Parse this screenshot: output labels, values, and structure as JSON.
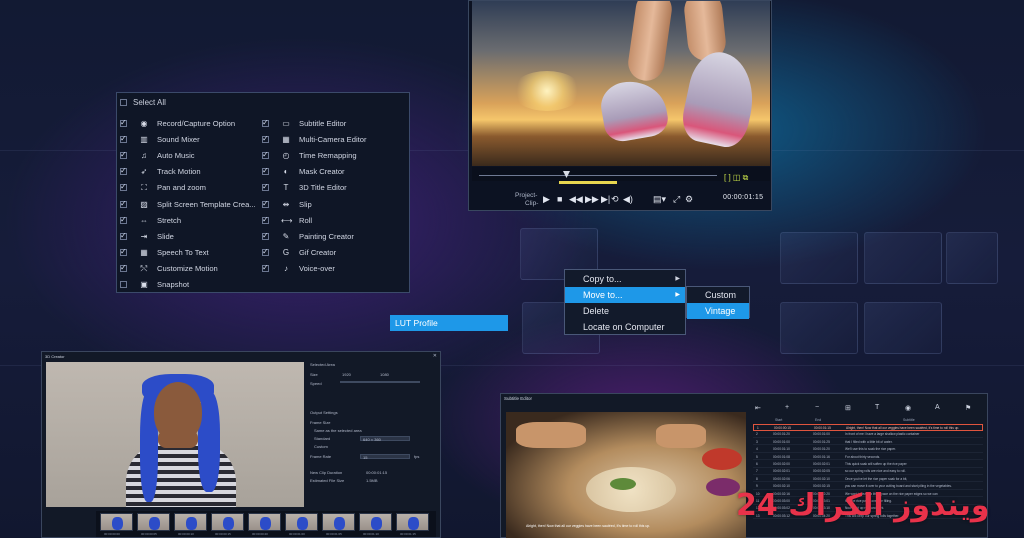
{
  "feature_panel": {
    "select_all": "Select All",
    "left_items": [
      {
        "label": "Record/Capture Option",
        "icon": "record-icon",
        "checked": true
      },
      {
        "label": "Sound Mixer",
        "icon": "sound-mixer-icon",
        "checked": true
      },
      {
        "label": "Auto Music",
        "icon": "music-note-icon",
        "checked": true
      },
      {
        "label": "Track Motion",
        "icon": "track-motion-icon",
        "checked": true
      },
      {
        "label": "Pan and zoom",
        "icon": "pan-zoom-icon",
        "checked": true
      },
      {
        "label": "Split Screen Template Crea...",
        "icon": "split-screen-icon",
        "checked": true
      },
      {
        "label": "Stretch",
        "icon": "stretch-icon",
        "checked": true
      },
      {
        "label": "Slide",
        "icon": "slide-icon",
        "checked": true
      },
      {
        "label": "Speech To Text",
        "icon": "speech-to-text-icon",
        "checked": true
      },
      {
        "label": "Customize Motion",
        "icon": "customize-motion-icon",
        "checked": true
      },
      {
        "label": "Snapshot",
        "icon": "camera-icon",
        "checked": false
      }
    ],
    "right_items": [
      {
        "label": "Subtitle Editor",
        "icon": "subtitle-icon",
        "checked": true
      },
      {
        "label": "Multi-Camera Editor",
        "icon": "multicam-icon",
        "checked": true
      },
      {
        "label": "Time Remapping",
        "icon": "clock-icon",
        "checked": true
      },
      {
        "label": "Mask Creator",
        "icon": "mask-icon",
        "checked": true
      },
      {
        "label": "3D Title Editor",
        "icon": "3d-title-icon",
        "checked": true
      },
      {
        "label": "Slip",
        "icon": "slip-icon",
        "checked": true
      },
      {
        "label": "Roll",
        "icon": "roll-icon",
        "checked": true
      },
      {
        "label": "Painting Creator",
        "icon": "paint-icon",
        "checked": true
      },
      {
        "label": "Gif Creator",
        "icon": "gif-icon",
        "checked": true
      },
      {
        "label": "Voice-over",
        "icon": "microphone-icon",
        "checked": true
      }
    ]
  },
  "preview": {
    "mode_label_1": "Project-",
    "mode_label_2": "Clip-",
    "timecode": "00:00:01:15"
  },
  "context_menu": {
    "items": [
      {
        "label": "Copy to...",
        "has_submenu": true
      },
      {
        "label": "Move to...",
        "has_submenu": true,
        "active": true
      },
      {
        "label": "Delete",
        "has_submenu": false
      },
      {
        "label": "Locate on Computer",
        "has_submenu": false
      }
    ],
    "submenu": [
      {
        "label": "Custom"
      },
      {
        "label": "Vintage",
        "active": true
      }
    ]
  },
  "lut_profile": "LUT Profile",
  "creator": {
    "title": "3D Creator",
    "selected_area": "Selected Area",
    "size_label": "Size",
    "w": "1920",
    "h": "1080",
    "speed_label": "Speed",
    "output_settings": "Output Settings",
    "frame_size": "Frame Size",
    "same_as_selected": "Same as the selected area",
    "standard": "Standard",
    "custom": "Custom",
    "frame_rate": "Frame Rate",
    "new_clip_duration": "New Clip Duration",
    "estimated_file_size": "Estimated File Size",
    "duration_value": "00:00:01:15",
    "file_size_value": "1.5MB",
    "standard_value": "640 × 360",
    "fps_value": "15",
    "fps_unit": "fps",
    "frame_timecodes": [
      "00:00:00:00",
      "00:00:00:05",
      "00:00:00:10",
      "00:00:00:15",
      "00:00:00:20",
      "00:00:01:00",
      "00:00:01:05",
      "00:00:01:10",
      "00:00:01:15"
    ]
  },
  "subtitle_editor": {
    "title": "Subtitle Editor",
    "columns": [
      "Start",
      "End",
      "Subtitle"
    ],
    "rows": [
      {
        "n": "1",
        "start": "00:00:00:15",
        "end": "00:00:01:15",
        "text": "Alright, then! Now that all our veggies have been sautéed, it's time to roll this up."
      },
      {
        "n": "2",
        "start": "00:00:01:20",
        "end": "00:00:01:00",
        "text": "In front of me I have a large shallow plastic container"
      },
      {
        "n": "3",
        "start": "00:00:01:00",
        "end": "00:00:01:25",
        "text": "that I filled with a little bit of water."
      },
      {
        "n": "4",
        "start": "00:00:01:10",
        "end": "00:00:01:20",
        "text": "We'll use this to soak the rice paper."
      },
      {
        "n": "5",
        "start": "00:00:01:08",
        "end": "00:00:01:16",
        "text": "For about thirty seconds."
      },
      {
        "n": "6",
        "start": "00:00:02:00",
        "end": "00:00:02:01",
        "text": "This quick soak will soften up the rice paper"
      },
      {
        "n": "7",
        "start": "00:00:02:01",
        "end": "00:00:02:05",
        "text": "so our spring rolls are nice and easy to roll."
      },
      {
        "n": "8",
        "start": "00:00:02:06",
        "end": "00:00:02:10",
        "text": "Once you've let the rice paper soak for a bit,"
      },
      {
        "n": "9",
        "start": "00:00:02:10",
        "end": "00:00:02:15",
        "text": "you can move it over to your cutting board and start piling in the vegetables."
      },
      {
        "n": "10",
        "start": "00:00:02:16",
        "end": "00:00:02:20",
        "text": "We want to leave a little space on the rice paper edges so we can"
      },
      {
        "n": "11",
        "start": "00:00:03:00",
        "end": "00:00:03:01",
        "text": "fold the rice paper over the filling."
      },
      {
        "n": "12",
        "start": "00:00:03:02",
        "end": "00:00:03:10",
        "text": "Now roll it up nice and tight."
      },
      {
        "n": "13",
        "start": "00:00:03:12",
        "end": "00:00:04:20",
        "text": "This will keep our spring rolls together."
      }
    ],
    "video_caption": "Alright, then! Now that all our veggies have been sautéed, it's time to roll this up."
  },
  "watermark": "24 ويندوز الكراك"
}
